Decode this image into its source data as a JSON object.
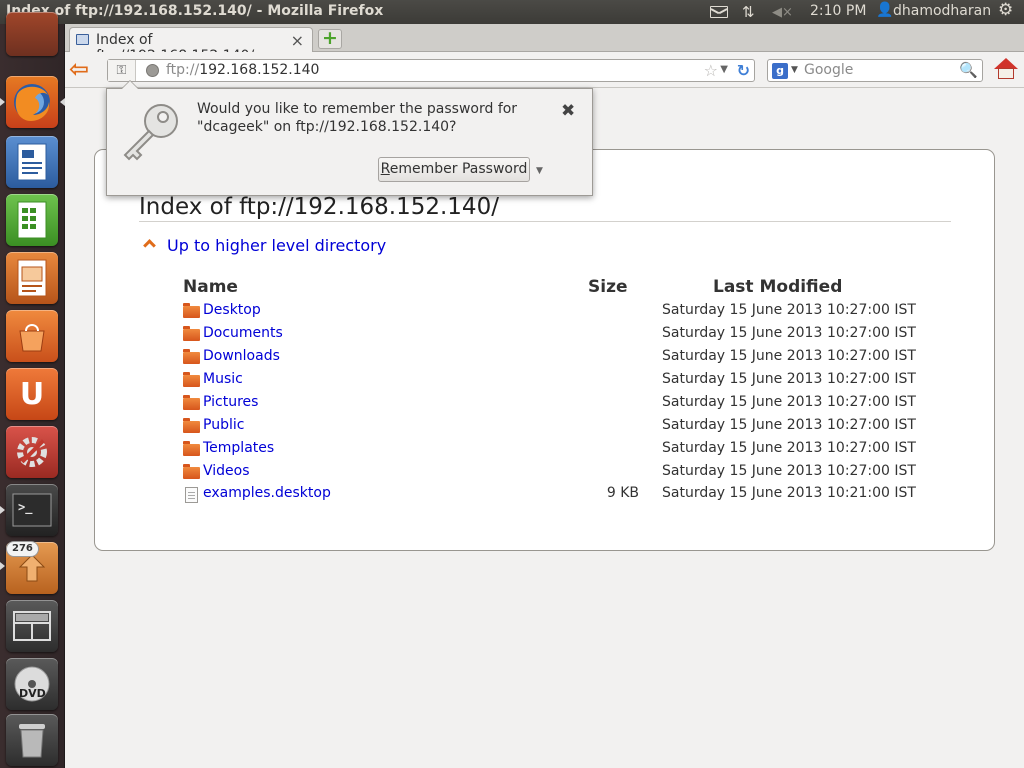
{
  "window": {
    "title": "Index of ftp://192.168.152.140/ - Mozilla Firefox"
  },
  "panel": {
    "clock": "2:10 PM",
    "user": "dhamodharan",
    "icons": [
      "mail-icon",
      "network-icon",
      "volume-muted-icon",
      "user-icon",
      "session-gear-icon"
    ]
  },
  "launcher": {
    "items": [
      {
        "name": "workspace-top",
        "icon": "app-icon"
      },
      {
        "name": "firefox",
        "icon": "firefox-icon"
      },
      {
        "name": "libreoffice-writer",
        "icon": "writer-icon"
      },
      {
        "name": "libreoffice-calc",
        "icon": "calc-icon"
      },
      {
        "name": "libreoffice-impress",
        "icon": "impress-icon"
      },
      {
        "name": "ubuntu-software-center",
        "icon": "software-center-icon"
      },
      {
        "name": "ubuntu-one",
        "icon": "ubuntu-one-icon"
      },
      {
        "name": "system-settings",
        "icon": "settings-icon"
      },
      {
        "name": "terminal",
        "icon": "terminal-icon"
      },
      {
        "name": "update-manager",
        "icon": "update-icon"
      },
      {
        "name": "workspace-switcher",
        "icon": "workspace-icon"
      },
      {
        "name": "dvd",
        "icon": "dvd-icon"
      },
      {
        "name": "trash",
        "icon": "trash-icon"
      }
    ],
    "update_badge": "276"
  },
  "tabs": [
    {
      "label": "Index of ftp://192.168.152.140/"
    }
  ],
  "navbar": {
    "url_scheme": "ftp://",
    "url_host": "192.168.152.140",
    "search_placeholder": "Google",
    "search_engine_letter": "g"
  },
  "page": {
    "title": "Index of ftp://192.168.152.140/",
    "up_link": "Up to higher level directory",
    "columns": {
      "name": "Name",
      "size": "Size",
      "modified": "Last Modified"
    },
    "rows": [
      {
        "name": "Desktop",
        "type": "folder",
        "size": "",
        "date": "Saturday 15 June 2013",
        "time": "10:27:00 IST"
      },
      {
        "name": "Documents",
        "type": "folder",
        "size": "",
        "date": "Saturday 15 June 2013",
        "time": "10:27:00 IST"
      },
      {
        "name": "Downloads",
        "type": "folder",
        "size": "",
        "date": "Saturday 15 June 2013",
        "time": "10:27:00 IST"
      },
      {
        "name": "Music",
        "type": "folder",
        "size": "",
        "date": "Saturday 15 June 2013",
        "time": "10:27:00 IST"
      },
      {
        "name": "Pictures",
        "type": "folder",
        "size": "",
        "date": "Saturday 15 June 2013",
        "time": "10:27:00 IST"
      },
      {
        "name": "Public",
        "type": "folder",
        "size": "",
        "date": "Saturday 15 June 2013",
        "time": "10:27:00 IST"
      },
      {
        "name": "Templates",
        "type": "folder",
        "size": "",
        "date": "Saturday 15 June 2013",
        "time": "10:27:00 IST"
      },
      {
        "name": "Videos",
        "type": "folder",
        "size": "",
        "date": "Saturday 15 June 2013",
        "time": "10:27:00 IST"
      },
      {
        "name": "examples.desktop",
        "type": "file",
        "size": "9 KB",
        "date": "Saturday 15 June 2013",
        "time": "10:21:00 IST"
      }
    ]
  },
  "password_prompt": {
    "message": "Would you like to remember the password for \"dcageek\" on ftp://192.168.152.140?",
    "button_first_letter": "R",
    "button_rest": "emember Password"
  },
  "colors": {
    "link": "#0000d6",
    "accent_orange": "#e06c1a",
    "folder": "#e8712b",
    "panel": "#3c3b37"
  }
}
